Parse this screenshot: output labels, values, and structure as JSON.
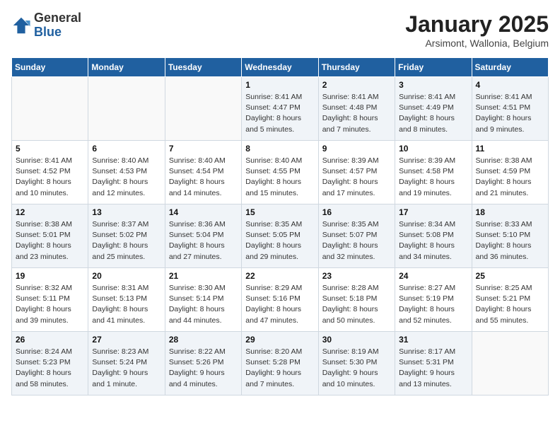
{
  "header": {
    "logo_general": "General",
    "logo_blue": "Blue",
    "month_title": "January 2025",
    "subtitle": "Arsimont, Wallonia, Belgium"
  },
  "days_of_week": [
    "Sunday",
    "Monday",
    "Tuesday",
    "Wednesday",
    "Thursday",
    "Friday",
    "Saturday"
  ],
  "weeks": [
    [
      {
        "day": "",
        "info": ""
      },
      {
        "day": "",
        "info": ""
      },
      {
        "day": "",
        "info": ""
      },
      {
        "day": "1",
        "info": "Sunrise: 8:41 AM\nSunset: 4:47 PM\nDaylight: 8 hours\nand 5 minutes."
      },
      {
        "day": "2",
        "info": "Sunrise: 8:41 AM\nSunset: 4:48 PM\nDaylight: 8 hours\nand 7 minutes."
      },
      {
        "day": "3",
        "info": "Sunrise: 8:41 AM\nSunset: 4:49 PM\nDaylight: 8 hours\nand 8 minutes."
      },
      {
        "day": "4",
        "info": "Sunrise: 8:41 AM\nSunset: 4:51 PM\nDaylight: 8 hours\nand 9 minutes."
      }
    ],
    [
      {
        "day": "5",
        "info": "Sunrise: 8:41 AM\nSunset: 4:52 PM\nDaylight: 8 hours\nand 10 minutes."
      },
      {
        "day": "6",
        "info": "Sunrise: 8:40 AM\nSunset: 4:53 PM\nDaylight: 8 hours\nand 12 minutes."
      },
      {
        "day": "7",
        "info": "Sunrise: 8:40 AM\nSunset: 4:54 PM\nDaylight: 8 hours\nand 14 minutes."
      },
      {
        "day": "8",
        "info": "Sunrise: 8:40 AM\nSunset: 4:55 PM\nDaylight: 8 hours\nand 15 minutes."
      },
      {
        "day": "9",
        "info": "Sunrise: 8:39 AM\nSunset: 4:57 PM\nDaylight: 8 hours\nand 17 minutes."
      },
      {
        "day": "10",
        "info": "Sunrise: 8:39 AM\nSunset: 4:58 PM\nDaylight: 8 hours\nand 19 minutes."
      },
      {
        "day": "11",
        "info": "Sunrise: 8:38 AM\nSunset: 4:59 PM\nDaylight: 8 hours\nand 21 minutes."
      }
    ],
    [
      {
        "day": "12",
        "info": "Sunrise: 8:38 AM\nSunset: 5:01 PM\nDaylight: 8 hours\nand 23 minutes."
      },
      {
        "day": "13",
        "info": "Sunrise: 8:37 AM\nSunset: 5:02 PM\nDaylight: 8 hours\nand 25 minutes."
      },
      {
        "day": "14",
        "info": "Sunrise: 8:36 AM\nSunset: 5:04 PM\nDaylight: 8 hours\nand 27 minutes."
      },
      {
        "day": "15",
        "info": "Sunrise: 8:35 AM\nSunset: 5:05 PM\nDaylight: 8 hours\nand 29 minutes."
      },
      {
        "day": "16",
        "info": "Sunrise: 8:35 AM\nSunset: 5:07 PM\nDaylight: 8 hours\nand 32 minutes."
      },
      {
        "day": "17",
        "info": "Sunrise: 8:34 AM\nSunset: 5:08 PM\nDaylight: 8 hours\nand 34 minutes."
      },
      {
        "day": "18",
        "info": "Sunrise: 8:33 AM\nSunset: 5:10 PM\nDaylight: 8 hours\nand 36 minutes."
      }
    ],
    [
      {
        "day": "19",
        "info": "Sunrise: 8:32 AM\nSunset: 5:11 PM\nDaylight: 8 hours\nand 39 minutes."
      },
      {
        "day": "20",
        "info": "Sunrise: 8:31 AM\nSunset: 5:13 PM\nDaylight: 8 hours\nand 41 minutes."
      },
      {
        "day": "21",
        "info": "Sunrise: 8:30 AM\nSunset: 5:14 PM\nDaylight: 8 hours\nand 44 minutes."
      },
      {
        "day": "22",
        "info": "Sunrise: 8:29 AM\nSunset: 5:16 PM\nDaylight: 8 hours\nand 47 minutes."
      },
      {
        "day": "23",
        "info": "Sunrise: 8:28 AM\nSunset: 5:18 PM\nDaylight: 8 hours\nand 50 minutes."
      },
      {
        "day": "24",
        "info": "Sunrise: 8:27 AM\nSunset: 5:19 PM\nDaylight: 8 hours\nand 52 minutes."
      },
      {
        "day": "25",
        "info": "Sunrise: 8:25 AM\nSunset: 5:21 PM\nDaylight: 8 hours\nand 55 minutes."
      }
    ],
    [
      {
        "day": "26",
        "info": "Sunrise: 8:24 AM\nSunset: 5:23 PM\nDaylight: 8 hours\nand 58 minutes."
      },
      {
        "day": "27",
        "info": "Sunrise: 8:23 AM\nSunset: 5:24 PM\nDaylight: 9 hours\nand 1 minute."
      },
      {
        "day": "28",
        "info": "Sunrise: 8:22 AM\nSunset: 5:26 PM\nDaylight: 9 hours\nand 4 minutes."
      },
      {
        "day": "29",
        "info": "Sunrise: 8:20 AM\nSunset: 5:28 PM\nDaylight: 9 hours\nand 7 minutes."
      },
      {
        "day": "30",
        "info": "Sunrise: 8:19 AM\nSunset: 5:30 PM\nDaylight: 9 hours\nand 10 minutes."
      },
      {
        "day": "31",
        "info": "Sunrise: 8:17 AM\nSunset: 5:31 PM\nDaylight: 9 hours\nand 13 minutes."
      },
      {
        "day": "",
        "info": ""
      }
    ]
  ]
}
